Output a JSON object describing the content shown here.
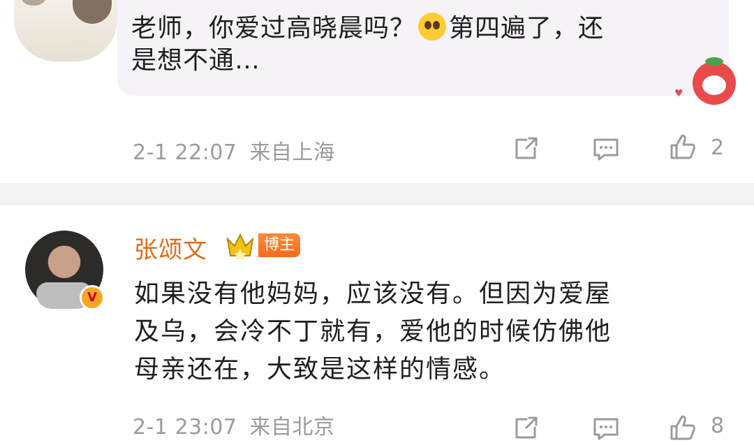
{
  "comment_1": {
    "text": "老师，你爱过高晓晨吗？🥺第四遍了，还是想不通…",
    "text_line_1_a": "老师，你爱过高晓晨吗？",
    "text_line_1_b": "第四遍了，还",
    "text_line_2": "是想不通…",
    "emoji": "pleading-face-icon",
    "timestamp": "2-1 22:07",
    "location": "来自上海",
    "like_count": "2"
  },
  "reply_1": {
    "username": "张颂文",
    "badge": "博主",
    "verified_badge": "V",
    "text_line_1": "如果没有他妈妈，应该没有。但因为爱屋",
    "text_line_2": "及乌，会冷不丁就有，爱他的时候仿佛他",
    "text_line_3": "母亲还在，大致是这样的情感。",
    "timestamp": "2-1 23:07",
    "location": "来自北京",
    "like_count": "8"
  },
  "watermark": "",
  "colors": {
    "username": "#e06c1a",
    "meta_gray": "#9b9b9b",
    "divider": "#f3f3f3",
    "bubble_bg": "#f5f2f8"
  },
  "icons": [
    "share-icon",
    "comment-icon",
    "like-icon"
  ]
}
